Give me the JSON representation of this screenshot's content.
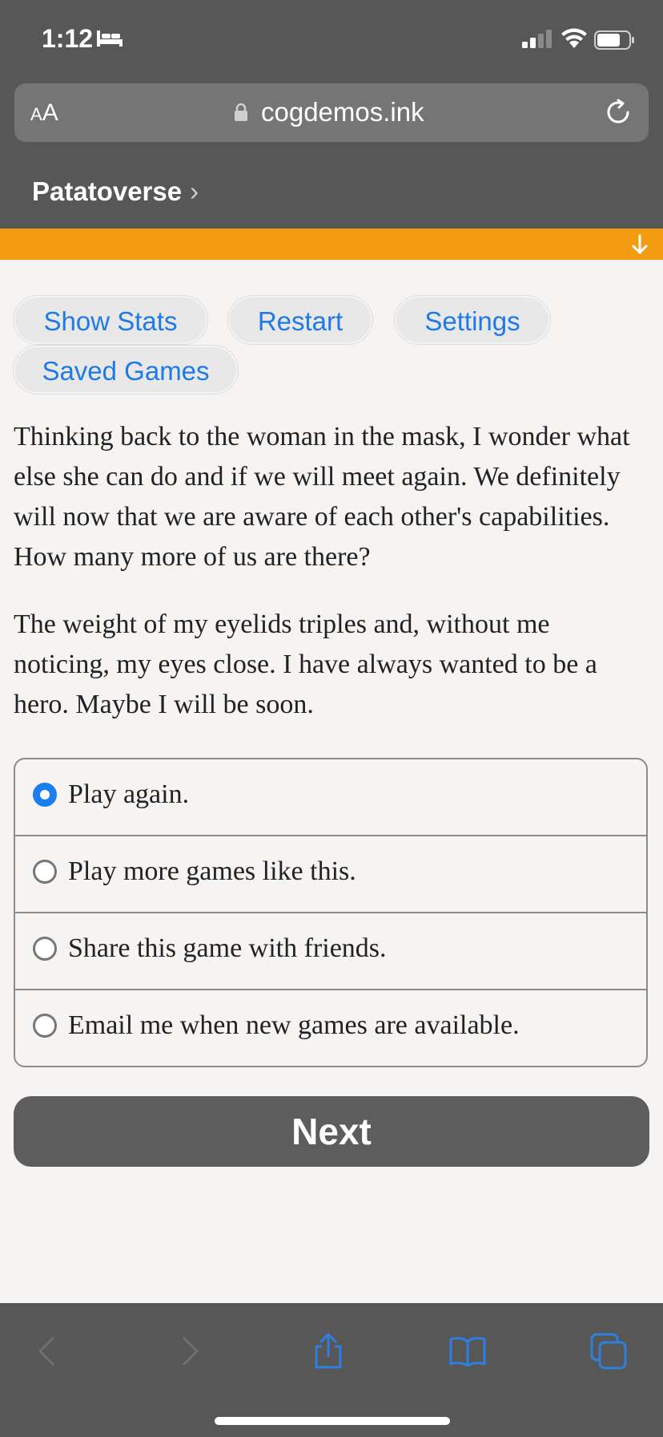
{
  "status_bar": {
    "time": "1:12",
    "icons": [
      "bed-icon",
      "cellular-signal-icon",
      "wifi-icon",
      "battery-icon"
    ]
  },
  "browser": {
    "text_size_label_small": "A",
    "text_size_label_large": "A",
    "url": "cogdemos.ink",
    "site_title": "Patatoverse",
    "site_title_chevron": "›"
  },
  "game_buttons": [
    {
      "label": "Show Stats"
    },
    {
      "label": "Restart"
    },
    {
      "label": "Settings"
    },
    {
      "label": "Saved Games"
    }
  ],
  "story": {
    "paragraphs": [
      "Thinking back to the woman in the mask, I wonder what else she can do and if we will meet again. We definitely will now that we are aware of each other's capabilities. How many more of us are there?",
      "The weight of my eyelids triples and, without me noticing, my eyes close. I have always wanted to be a hero. Maybe I will be soon."
    ]
  },
  "choices": [
    {
      "label": "Play again.",
      "selected": true
    },
    {
      "label": "Play more games like this.",
      "selected": false
    },
    {
      "label": "Share this game with friends.",
      "selected": false
    },
    {
      "label": "Email me when new games are available.",
      "selected": false
    }
  ],
  "next_button": {
    "label": "Next"
  },
  "colors": {
    "chrome": "#575757",
    "accent_orange": "#f39c12",
    "link_blue": "#1f7ae6",
    "radio_selected": "#1a7ef0",
    "next_button": "#5d5d5d",
    "page_background": "#f6f4f2"
  }
}
